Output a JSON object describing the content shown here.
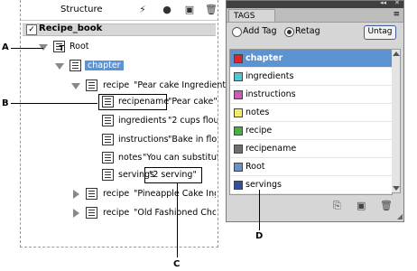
{
  "structure": {
    "title": "Structure",
    "root_label": "Recipe_book",
    "tools": [
      {
        "name": "lightning-icon",
        "glyph": "⚡"
      },
      {
        "name": "dot-icon",
        "glyph": "●"
      },
      {
        "name": "new-element-icon",
        "glyph": "▣"
      },
      {
        "name": "trash-icon",
        "glyph": "🗑"
      }
    ],
    "rows": {
      "root": "Root",
      "chapter": "chapter",
      "recipe1": "recipe",
      "recipe1_value": "\"Pear cake Ingredients",
      "recipename": "recipename",
      "recipename_value": "\"Pear cake\"",
      "ingredients": "ingredients",
      "ingredients_value": "\"2 cups flour",
      "instructions": "instructions",
      "instructions_value": "\"Bake in flou",
      "notes": "notes",
      "notes_value": "\"You can substitute",
      "servings": "servings",
      "servings_value": "\"2 serving\"",
      "recipe2": "recipe",
      "recipe2_value": "\"Pineapple Cake Ingre",
      "recipe3": "recipe",
      "recipe3_value": "\"Old Fashioned Choco"
    }
  },
  "callouts": {
    "a": "A",
    "b": "B",
    "c": "C",
    "d": "D"
  },
  "tags_panel": {
    "title_arrows": "◂◂",
    "close": "✕",
    "tab_label": "TAGS",
    "menu_icon": "≡",
    "add_tag_label": "Add Tag",
    "retag_label": "Retag",
    "untag_label": "Untag",
    "items": [
      {
        "label": "chapter",
        "color": "#d9262b"
      },
      {
        "label": "ingredients",
        "color": "#58c3d6"
      },
      {
        "label": "instructions",
        "color": "#c65fb3"
      },
      {
        "label": "notes",
        "color": "#f4ea6f"
      },
      {
        "label": "recipe",
        "color": "#4bae45"
      },
      {
        "label": "recipename",
        "color": "#6e6e6e"
      },
      {
        "label": "Root",
        "color": "#6d8fc9"
      },
      {
        "label": "servings",
        "color": "#35509b"
      }
    ]
  }
}
